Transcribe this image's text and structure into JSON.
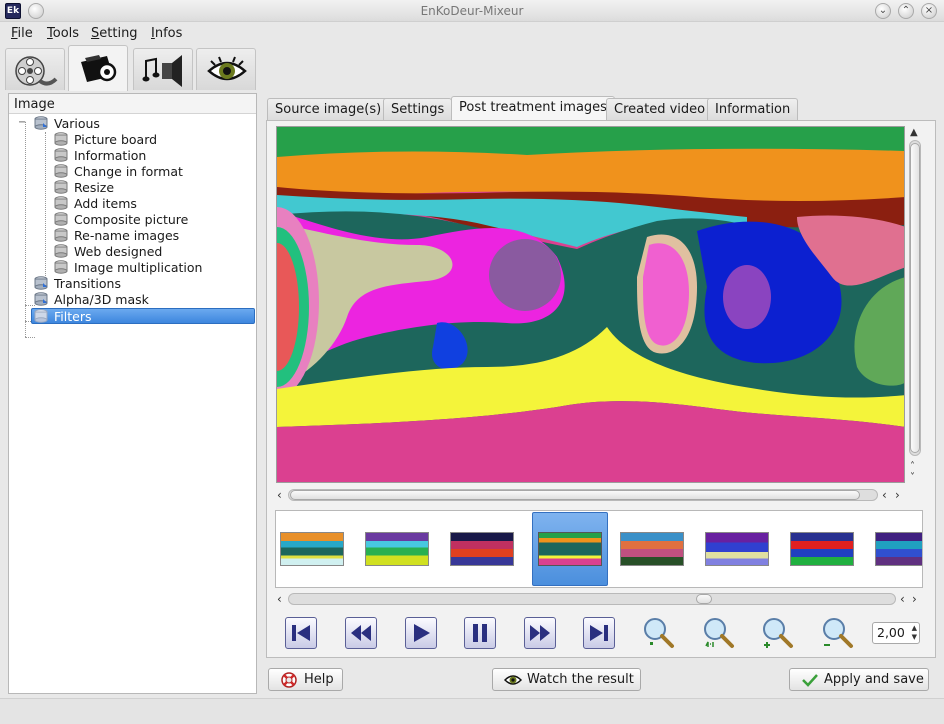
{
  "window": {
    "title": "EnKoDeur-Mixeur",
    "app_icon_text": "Ek"
  },
  "menu": {
    "items": [
      "File",
      "Tools",
      "Setting",
      "Infos"
    ]
  },
  "mode_tabs": [
    {
      "name": "video-reel",
      "icon": "film-reel-icon"
    },
    {
      "name": "image",
      "icon": "camera-icon"
    },
    {
      "name": "audio",
      "icon": "speaker-music-icon"
    },
    {
      "name": "view",
      "icon": "eye-icon"
    }
  ],
  "left_panel": {
    "header": "Image",
    "tree": {
      "various": "Various",
      "children": [
        "Picture board",
        "Information",
        "Change in format",
        "Resize",
        "Add items",
        "Composite picture",
        "Re-name images",
        "Web designed",
        "Image multiplication"
      ],
      "transitions": "Transitions",
      "alpha": "Alpha/3D mask",
      "filters": "Filters"
    }
  },
  "tabs": [
    "Source image(s)",
    "Settings",
    "Post treatment images",
    "Created video",
    "Information"
  ],
  "active_tab": "Post treatment images",
  "zoom": {
    "value": "2,00"
  },
  "controls": [
    "first",
    "rewind",
    "play",
    "pause",
    "forward",
    "last"
  ],
  "zoom_tools": [
    "zoom-fit",
    "zoom-1to1",
    "zoom-in",
    "zoom-out"
  ],
  "buttons": {
    "help": "Help",
    "watch": "Watch the result",
    "apply": "Apply and save"
  },
  "colors": {
    "selection": "#3d86de",
    "control_accent": "#2a2f80"
  }
}
